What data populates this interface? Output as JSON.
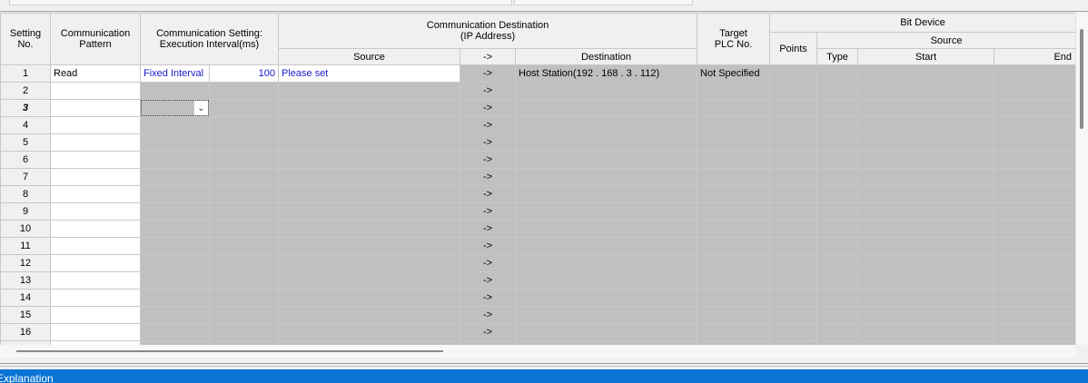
{
  "header": {
    "setting_no": "Setting\nNo.",
    "comm_pattern": "Communication\nPattern",
    "comm_setting": "Communication Setting:\nExecution Interval(ms)",
    "comm_dest": "Communication Destination\n(IP Address)",
    "source": "Source",
    "arrow": "->",
    "destination": "Destination",
    "target_plc": "Target\nPLC No.",
    "bit_device": "Bit Device",
    "points": "Points",
    "bit_source": "Source",
    "type": "Type",
    "start": "Start",
    "end": "End"
  },
  "rows": [
    {
      "no": "1",
      "pattern": "Read",
      "mode": "Fixed Interval",
      "interval": "100",
      "source": "Please set",
      "arrow": "->",
      "destination": "Host Station(192 . 168 .   3 . 112)",
      "target": "Not Specified"
    },
    {
      "no": "2",
      "pattern": "",
      "mode": "",
      "interval": "",
      "source": "",
      "arrow": "->",
      "destination": "",
      "target": ""
    },
    {
      "no": "3",
      "pattern": "",
      "mode": "",
      "interval": "",
      "source": "",
      "arrow": "->",
      "destination": "",
      "target": ""
    },
    {
      "no": "4",
      "pattern": "",
      "mode": "",
      "interval": "",
      "source": "",
      "arrow": "->",
      "destination": "",
      "target": ""
    },
    {
      "no": "5",
      "pattern": "",
      "mode": "",
      "interval": "",
      "source": "",
      "arrow": "->",
      "destination": "",
      "target": ""
    },
    {
      "no": "6",
      "pattern": "",
      "mode": "",
      "interval": "",
      "source": "",
      "arrow": "->",
      "destination": "",
      "target": ""
    },
    {
      "no": "7",
      "pattern": "",
      "mode": "",
      "interval": "",
      "source": "",
      "arrow": "->",
      "destination": "",
      "target": ""
    },
    {
      "no": "8",
      "pattern": "",
      "mode": "",
      "interval": "",
      "source": "",
      "arrow": "->",
      "destination": "",
      "target": ""
    },
    {
      "no": "9",
      "pattern": "",
      "mode": "",
      "interval": "",
      "source": "",
      "arrow": "->",
      "destination": "",
      "target": ""
    },
    {
      "no": "10",
      "pattern": "",
      "mode": "",
      "interval": "",
      "source": "",
      "arrow": "->",
      "destination": "",
      "target": ""
    },
    {
      "no": "11",
      "pattern": "",
      "mode": "",
      "interval": "",
      "source": "",
      "arrow": "->",
      "destination": "",
      "target": ""
    },
    {
      "no": "12",
      "pattern": "",
      "mode": "",
      "interval": "",
      "source": "",
      "arrow": "->",
      "destination": "",
      "target": ""
    },
    {
      "no": "13",
      "pattern": "",
      "mode": "",
      "interval": "",
      "source": "",
      "arrow": "->",
      "destination": "",
      "target": ""
    },
    {
      "no": "14",
      "pattern": "",
      "mode": "",
      "interval": "",
      "source": "",
      "arrow": "->",
      "destination": "",
      "target": ""
    },
    {
      "no": "15",
      "pattern": "",
      "mode": "",
      "interval": "",
      "source": "",
      "arrow": "->",
      "destination": "",
      "target": ""
    },
    {
      "no": "16",
      "pattern": "",
      "mode": "",
      "interval": "",
      "source": "",
      "arrow": "->",
      "destination": "",
      "target": ""
    }
  ],
  "current_row": "3",
  "combo_icon": "chevron-down-icon",
  "explanation": {
    "title": "Explanation"
  },
  "colors": {
    "disabled_cell": "#c0c0c0",
    "link_blue": "#1a1acc",
    "explain_bar": "#0a74d4"
  }
}
